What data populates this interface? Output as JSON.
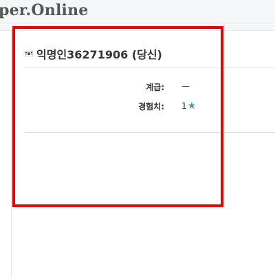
{
  "site": {
    "title": "per.Online"
  },
  "profile": {
    "flag_icon": "south-korea-flag-icon",
    "username": "익명인36271906 (당신)",
    "stats": [
      {
        "label": "계급:",
        "value": "—"
      },
      {
        "label": "경험치:",
        "value": "1",
        "icon": "★"
      }
    ]
  },
  "colors": {
    "highlight": "#ee0000",
    "star": "#4a8fa5",
    "topbar": "#f5f6f7"
  }
}
